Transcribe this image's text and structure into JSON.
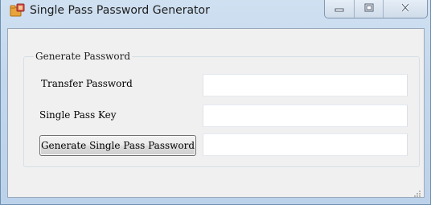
{
  "window": {
    "title": "Single Pass Password Generator",
    "icon": "folder-lock-icon"
  },
  "caption_buttons": {
    "minimize_icon": "minimize-icon",
    "maximize_icon": "maximize-icon",
    "close_icon": "close-icon"
  },
  "group": {
    "legend": "Generate Password"
  },
  "form": {
    "transfer_password_label": "Transfer Password",
    "transfer_password_value": "",
    "single_pass_key_label": "Single Pass Key",
    "single_pass_key_value": "",
    "generate_button_label": "Generate Single Pass Password",
    "result_value": ""
  },
  "colors": {
    "title_bar": "#c3d7ec",
    "client_bg": "#f0f0f0"
  }
}
